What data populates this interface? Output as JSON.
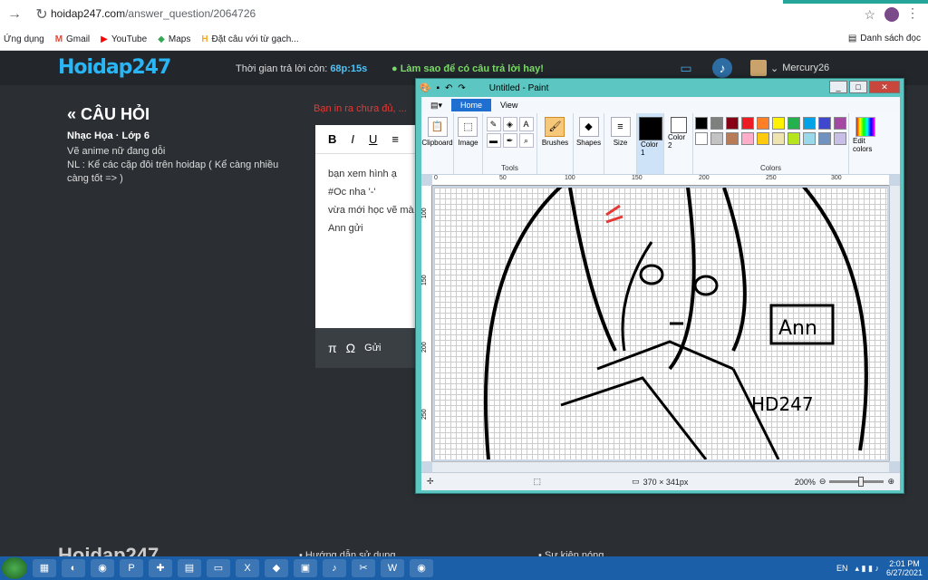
{
  "browser": {
    "url_host": "hoidap247.com",
    "url_path": "/answer_question/2064726",
    "bookmarks": [
      {
        "label": "Ứng dụng",
        "icon": "apps-grid-icon"
      },
      {
        "label": "Gmail",
        "icon": "gmail-icon"
      },
      {
        "label": "YouTube",
        "icon": "youtube-icon"
      },
      {
        "label": "Maps",
        "icon": "maps-icon"
      },
      {
        "label": "Đặt câu với từ gạch...",
        "icon": "hoidap-icon"
      }
    ],
    "reading_list": "Danh sách đọc"
  },
  "site": {
    "logo": "Hoidap247",
    "timer_label": "Thời gian trả lời còn:",
    "timer_value": "68p:15s",
    "tip": "Làm sao để có câu trả lời hay!",
    "username": "Mercury26"
  },
  "question": {
    "back_label": "CÂU HỎI",
    "meta": "Nhạc Họa · Lớp 6",
    "line1": "Vẽ anime nữ đang dỗi",
    "line2": "NL : Kể các cặp đôi trên hoidap ( Kể càng nhiều càng tốt => )"
  },
  "warning": "Bạn in ra chưa đủ, ...",
  "editor": {
    "toolbar": [
      "B",
      "I",
      "U",
      "≡"
    ],
    "lines": [
      "bạn xem hình ạ",
      "#Oc nha '-'",
      "vừa mới học vẽ mà",
      "Ann gửi"
    ],
    "footer": [
      "π",
      "Ω",
      "Gửi"
    ]
  },
  "paint": {
    "title": "Untitled - Paint",
    "tabs": [
      "Home",
      "View"
    ],
    "groups": {
      "clipboard": "Clipboard",
      "image": "Image",
      "tools": "Tools",
      "brushes": "Brushes",
      "shapes": "Shapes",
      "size": "Size",
      "color1": "Color 1",
      "color2": "Color 2",
      "colors": "Colors",
      "edit_colors": "Edit colors"
    },
    "ruler_h": [
      "0",
      "50",
      "100",
      "150",
      "200",
      "250",
      "300"
    ],
    "ruler_v": [
      "100",
      "150",
      "200",
      "250"
    ],
    "canvas_size": "370 × 341px",
    "zoom": "200%",
    "palette": [
      "#000000",
      "#7f7f7f",
      "#880015",
      "#ed1c24",
      "#ff7f27",
      "#fff200",
      "#22b14c",
      "#00a2e8",
      "#3f48cc",
      "#a349a4",
      "#ffffff",
      "#c3c3c3",
      "#b97a57",
      "#ffaec9",
      "#ffc90e",
      "#efe4b0",
      "#b5e61d",
      "#99d9ea",
      "#7092be",
      "#c8bfe7"
    ],
    "sketch_text": [
      "Ann",
      "HD247"
    ]
  },
  "footer": {
    "logo": "Hoidap247",
    "links": [
      "Hướng dẫn sử dụng",
      "Sự kiện nóng"
    ]
  },
  "taskbar": {
    "lang": "EN",
    "time": "2:01 PM",
    "date": "6/27/2021"
  }
}
